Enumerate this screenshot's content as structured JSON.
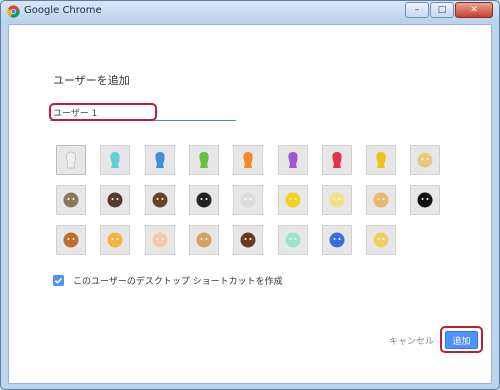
{
  "window": {
    "title": "Google Chrome",
    "icon": "chrome-icon"
  },
  "dialog": {
    "heading": "ユーザーを追加",
    "name_value": "ユーザー 1",
    "checkbox_label": "このユーザーのデスクトップ ショートカットを作成",
    "checkbox_checked": true,
    "cancel_label": "キャンセル",
    "add_label": "追加"
  },
  "avatars": [
    {
      "name": "avatar-generic-white",
      "color": "#ededed",
      "selected": true
    },
    {
      "name": "avatar-generic-aqua",
      "color": "#5fd0d8"
    },
    {
      "name": "avatar-generic-blue",
      "color": "#3b8fe0"
    },
    {
      "name": "avatar-generic-green",
      "color": "#63c23c"
    },
    {
      "name": "avatar-generic-orange",
      "color": "#f08a2c"
    },
    {
      "name": "avatar-generic-purple",
      "color": "#9b59d0"
    },
    {
      "name": "avatar-generic-red",
      "color": "#e2334e"
    },
    {
      "name": "avatar-generic-yellow",
      "color": "#f2c21a"
    },
    {
      "name": "avatar-secret-agent",
      "color": "#e8c87a"
    },
    {
      "name": "avatar-superhero",
      "color": "#8a7a5a"
    },
    {
      "name": "avatar-volley-ball",
      "color": "#5a3a2a"
    },
    {
      "name": "avatar-businessman",
      "color": "#6b4226"
    },
    {
      "name": "avatar-ninja",
      "color": "#222222"
    },
    {
      "name": "avatar-alien",
      "color": "#dcdcdc"
    },
    {
      "name": "avatar-awesome",
      "color": "#f6d21c"
    },
    {
      "name": "avatar-flower",
      "color": "#f5e08a"
    },
    {
      "name": "avatar-pizza",
      "color": "#e8b870"
    },
    {
      "name": "avatar-soccer",
      "color": "#111111"
    },
    {
      "name": "avatar-burger",
      "color": "#b8702a"
    },
    {
      "name": "avatar-cat",
      "color": "#f2b43a"
    },
    {
      "name": "avatar-cupcake",
      "color": "#f2c8b0"
    },
    {
      "name": "avatar-dog",
      "color": "#d8a060"
    },
    {
      "name": "avatar-horse",
      "color": "#6b3a1e"
    },
    {
      "name": "avatar-margarita",
      "color": "#9be3d0"
    },
    {
      "name": "avatar-note",
      "color": "#3a6fd8"
    },
    {
      "name": "avatar-sun-cloud",
      "color": "#f2d060"
    }
  ]
}
